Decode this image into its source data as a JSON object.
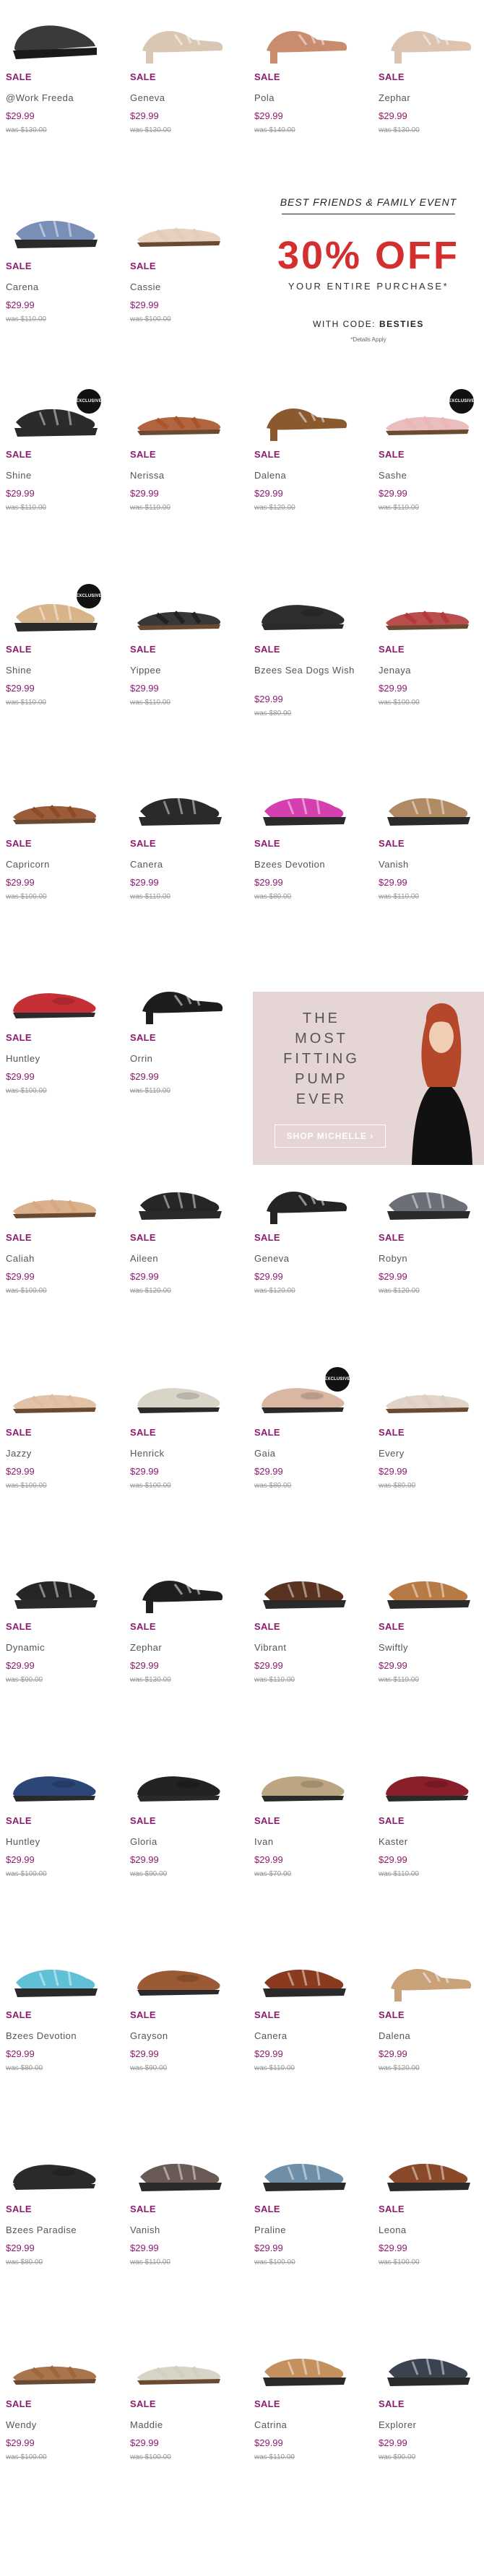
{
  "badge_text": "EXCLUSIVE",
  "promo": {
    "event": "BEST FRIENDS & FAMILY EVENT",
    "headline": "30% OFF",
    "subline": "YOUR ENTIRE PURCHASE*",
    "code_label": "WITH CODE:",
    "code": "BESTIES",
    "disclaimer": "*Details Apply"
  },
  "ad": {
    "line1": "THE",
    "line2": "MOST",
    "line3": "FITTING",
    "line4": "PUMP",
    "line5": "EVER",
    "cta": "SHOP MICHELLE ›"
  },
  "rows": [
    [
      {
        "sale": "SALE",
        "name": "@Work Freeda",
        "price": "$29.99",
        "was": "was $130.00",
        "color": "#3a3a3a",
        "style": "clog"
      },
      {
        "sale": "SALE",
        "name": "Geneva",
        "price": "$29.99",
        "was": "was $130.00",
        "color": "#d9c7b3",
        "style": "heel"
      },
      {
        "sale": "SALE",
        "name": "Pola",
        "price": "$29.99",
        "was": "was $140.00",
        "color": "#c98c6e",
        "style": "heel"
      },
      {
        "sale": "SALE",
        "name": "Zephar",
        "price": "$29.99",
        "was": "was $130.00",
        "color": "#dcc4b0",
        "style": "heel"
      }
    ],
    [
      {
        "sale": "SALE",
        "name": "Carena",
        "price": "$29.99",
        "was": "was $110.00",
        "color": "#7a8fb8",
        "style": "wedge"
      },
      {
        "sale": "SALE",
        "name": "Cassie",
        "price": "$29.99",
        "was": "was $100.00",
        "color": "#e3cdb8",
        "style": "flat"
      }
    ],
    [
      {
        "sale": "SALE",
        "name": "Shine",
        "price": "$29.99",
        "was": "was $110.00",
        "color": "#2b2b2b",
        "style": "wedge",
        "badge": true
      },
      {
        "sale": "SALE",
        "name": "Nerissa",
        "price": "$29.99",
        "was": "was $110.00",
        "color": "#a8552c",
        "style": "flat"
      },
      {
        "sale": "SALE",
        "name": "Dalena",
        "price": "$29.99",
        "was": "was $120.00",
        "color": "#8a5a2e",
        "style": "heel"
      },
      {
        "sale": "SALE",
        "name": "Sashe",
        "price": "$29.99",
        "was": "was $110.00",
        "color": "#e9b7b7",
        "style": "flat",
        "badge": true
      }
    ],
    [
      {
        "sale": "SALE",
        "name": "Shine",
        "price": "$29.99",
        "was": "was $110.00",
        "color": "#d8b48a",
        "style": "wedge",
        "badge": true
      },
      {
        "sale": "SALE",
        "name": "Yippee",
        "price": "$29.99",
        "was": "was $110.00",
        "color": "#222222",
        "style": "flat"
      },
      {
        "sale": "SALE",
        "name": "Bzees Sea Dogs Wish",
        "price": "$29.99",
        "was": "was $80.00",
        "color": "#2e2e2e",
        "style": "loafer",
        "twoline": true
      },
      {
        "sale": "SALE",
        "name": "Jenaya",
        "price": "$29.99",
        "was": "was $100.00",
        "color": "#b33a3a",
        "style": "flat"
      }
    ],
    [
      {
        "sale": "SALE",
        "name": "Capricorn",
        "price": "$29.99",
        "was": "was $100.00",
        "color": "#8f4a26",
        "style": "flat"
      },
      {
        "sale": "SALE",
        "name": "Canera",
        "price": "$29.99",
        "was": "was $110.00",
        "color": "#2a2a2a",
        "style": "wedge"
      },
      {
        "sale": "SALE",
        "name": "Bzees Devotion",
        "price": "$29.99",
        "was": "was $80.00",
        "color": "#d63fb0",
        "style": "wedge"
      },
      {
        "sale": "SALE",
        "name": "Vanish",
        "price": "$29.99",
        "was": "was $110.00",
        "color": "#b08a62",
        "style": "wedge"
      }
    ],
    [
      {
        "sale": "SALE",
        "name": "Huntley",
        "price": "$29.99",
        "was": "was $100.00",
        "color": "#c62f36",
        "style": "loafer"
      },
      {
        "sale": "SALE",
        "name": "Orrin",
        "price": "$29.99",
        "was": "was $110.00",
        "color": "#1d1d1d",
        "style": "heel"
      }
    ],
    [
      {
        "sale": "SALE",
        "name": "Caliah",
        "price": "$29.99",
        "was": "was $100.00",
        "color": "#d6a880",
        "style": "flat"
      },
      {
        "sale": "SALE",
        "name": "Aileen",
        "price": "$29.99",
        "was": "was $120.00",
        "color": "#262626",
        "style": "wedge"
      },
      {
        "sale": "SALE",
        "name": "Geneva",
        "price": "$29.99",
        "was": "was $120.00",
        "color": "#242424",
        "style": "heel"
      },
      {
        "sale": "SALE",
        "name": "Robyn",
        "price": "$29.99",
        "was": "was $120.00",
        "color": "#6b6f78",
        "style": "wedge"
      }
    ],
    [
      {
        "sale": "SALE",
        "name": "Jazzy",
        "price": "$29.99",
        "was": "was $100.00",
        "color": "#e0bd9e",
        "style": "flat"
      },
      {
        "sale": "SALE",
        "name": "Henrick",
        "price": "$29.99",
        "was": "was $100.00",
        "color": "#d9d4c8",
        "style": "loafer"
      },
      {
        "sale": "SALE",
        "name": "Gaia",
        "price": "$29.99",
        "was": "was $80.00",
        "color": "#d9b7a2",
        "style": "loafer",
        "badge": true
      },
      {
        "sale": "SALE",
        "name": "Every",
        "price": "$29.99",
        "was": "was $80.00",
        "color": "#ddd0c2",
        "style": "flat"
      }
    ],
    [
      {
        "sale": "SALE",
        "name": "Dynamic",
        "price": "$29.99",
        "was": "was $90.00",
        "color": "#262626",
        "style": "wedge"
      },
      {
        "sale": "SALE",
        "name": "Zephar",
        "price": "$29.99",
        "was": "was $130.00",
        "color": "#1f1f1f",
        "style": "heel"
      },
      {
        "sale": "SALE",
        "name": "Vibrant",
        "price": "$29.99",
        "was": "was $110.00",
        "color": "#5a3320",
        "style": "wedge"
      },
      {
        "sale": "SALE",
        "name": "Swiftly",
        "price": "$29.99",
        "was": "was $110.00",
        "color": "#b87a45",
        "style": "wedge"
      }
    ],
    [
      {
        "sale": "SALE",
        "name": "Huntley",
        "price": "$29.99",
        "was": "was $100.00",
        "color": "#2c4677",
        "style": "loafer"
      },
      {
        "sale": "SALE",
        "name": "Gloria",
        "price": "$29.99",
        "was": "was $90.00",
        "color": "#222222",
        "style": "loafer"
      },
      {
        "sale": "SALE",
        "name": "Ivan",
        "price": "$29.99",
        "was": "was $70.00",
        "color": "#bca682",
        "style": "loafer"
      },
      {
        "sale": "SALE",
        "name": "Kaster",
        "price": "$29.99",
        "was": "was $110.00",
        "color": "#8a1f2b",
        "style": "loafer"
      }
    ],
    [
      {
        "sale": "SALE",
        "name": "Bzees Devotion",
        "price": "$29.99",
        "was": "was $80.00",
        "color": "#5fc0d6",
        "style": "wedge"
      },
      {
        "sale": "SALE",
        "name": "Grayson",
        "price": "$29.99",
        "was": "was $90.00",
        "color": "#9a5a36",
        "style": "loafer"
      },
      {
        "sale": "SALE",
        "name": "Canera",
        "price": "$29.99",
        "was": "was $110.00",
        "color": "#8a3a1e",
        "style": "wedge"
      },
      {
        "sale": "SALE",
        "name": "Dalena",
        "price": "$29.99",
        "was": "was $120.00",
        "color": "#c9a27a",
        "style": "heel"
      }
    ],
    [
      {
        "sale": "SALE",
        "name": "Bzees Paradise",
        "price": "$29.99",
        "was": "was $80.00",
        "color": "#2a2a2a",
        "style": "loafer"
      },
      {
        "sale": "SALE",
        "name": "Vanish",
        "price": "$29.99",
        "was": "was $110.00",
        "color": "#6a5a55",
        "style": "wedge"
      },
      {
        "sale": "SALE",
        "name": "Praline",
        "price": "$29.99",
        "was": "was $100.00",
        "color": "#6f8fa8",
        "style": "wedge"
      },
      {
        "sale": "SALE",
        "name": "Leona",
        "price": "$29.99",
        "was": "was $100.00",
        "color": "#8a4a2a",
        "style": "wedge"
      }
    ],
    [
      {
        "sale": "SALE",
        "name": "Wendy",
        "price": "$29.99",
        "was": "was $100.00",
        "color": "#a0663c",
        "style": "flat"
      },
      {
        "sale": "SALE",
        "name": "Maddie",
        "price": "$29.99",
        "was": "was $100.00",
        "color": "#d3d0c0",
        "style": "flat"
      },
      {
        "sale": "SALE",
        "name": "Catrina",
        "price": "$29.99",
        "was": "was $110.00",
        "color": "#c4905e",
        "style": "wedge"
      },
      {
        "sale": "SALE",
        "name": "Explorer",
        "price": "$29.99",
        "was": "was $90.00",
        "color": "#3b4250",
        "style": "wedge"
      }
    ]
  ]
}
